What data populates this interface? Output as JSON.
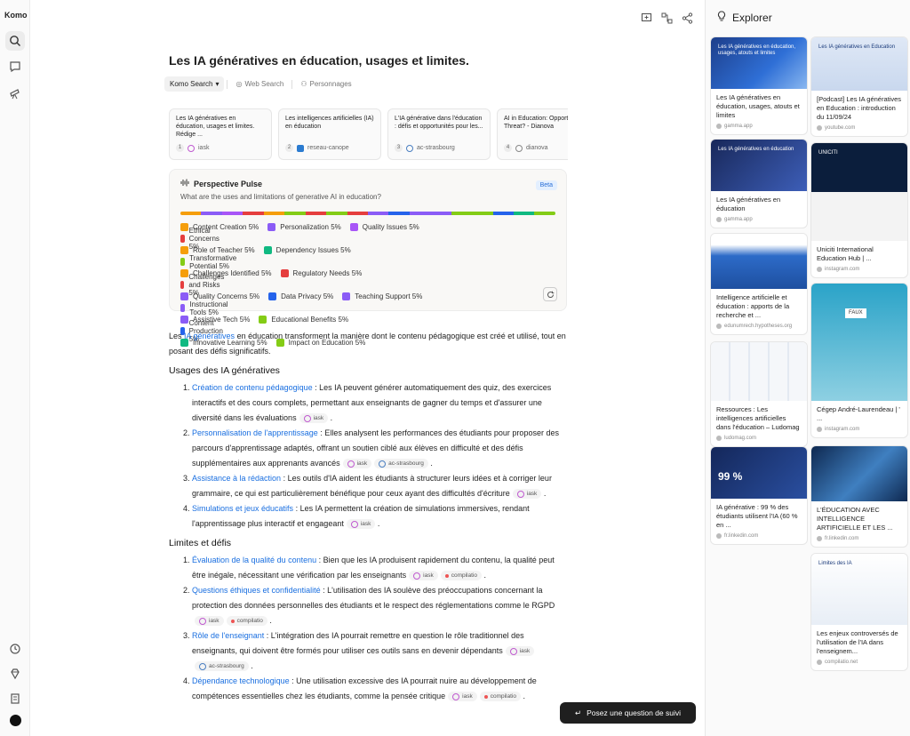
{
  "app": {
    "name": "Komo"
  },
  "main": {
    "title": "Les IA génératives en éducation, usages et limites.",
    "modes": [
      {
        "label": "Komo Search"
      },
      {
        "label": "Web Search"
      },
      {
        "label": "Personnages"
      }
    ],
    "sources": [
      {
        "num": "1",
        "title": "Les IA génératives en éducation, usages et limites. Rédige ...",
        "site": "iask"
      },
      {
        "num": "2",
        "title": "Les intelligences artificielles (IA) en éducation",
        "site": "reseau-canope"
      },
      {
        "num": "3",
        "title": "L'IA générative dans l'éducation : défis et opportunités pour les...",
        "site": "ac-strasbourg"
      },
      {
        "num": "4",
        "title": "AI in Education: Opportunity or Threat? - Dianova",
        "site": "dianova"
      }
    ],
    "followup_label": "Posez une question de suivi"
  },
  "pulse": {
    "title": "Perspective Pulse",
    "badge": "Beta",
    "question": "What are the uses and limitations of generative AI in education?",
    "bar_colors": [
      "#f59e0b",
      "#8b5cf6",
      "#a855f7",
      "#e53e3e",
      "#f59e0b",
      "#84cc16",
      "#e53e3e",
      "#84cc16",
      "#e53e3e",
      "#8b5cf6",
      "#2563eb",
      "#8b5cf6",
      "#8b5cf6",
      "#84cc16",
      "#84cc16",
      "#2563eb",
      "#10b981",
      "#84cc16"
    ],
    "items": [
      {
        "label": "Content Creation 5%",
        "color": "#f59e0b"
      },
      {
        "label": "Personalization 5%",
        "color": "#8b5cf6"
      },
      {
        "label": "Quality Issues 5%",
        "color": "#a855f7"
      },
      {
        "label": "Ethical Concerns 5%",
        "color": "#e53e3e"
      },
      {
        "label": "Role of Teacher 5%",
        "color": "#f59e0b"
      },
      {
        "label": "Dependency Issues 5%",
        "color": "#10b981"
      },
      {
        "label": "Transformative Potential 5%",
        "color": "#84cc16"
      },
      {
        "label": "Challenges Identified 5%",
        "color": "#f59e0b"
      },
      {
        "label": "Regulatory Needs 5%",
        "color": "#e53e3e"
      },
      {
        "label": "Challenges and Risks 5%",
        "color": "#e53e3e"
      },
      {
        "label": "Quality Concerns 5%",
        "color": "#8b5cf6"
      },
      {
        "label": "Data Privacy 5%",
        "color": "#2563eb"
      },
      {
        "label": "Teaching Support 5%",
        "color": "#8b5cf6"
      },
      {
        "label": "Instructional Tools 5%",
        "color": "#8b5cf6"
      },
      {
        "label": "Assistive Tech 5%",
        "color": "#8b5cf6"
      },
      {
        "label": "Educational Benefits 5%",
        "color": "#84cc16"
      },
      {
        "label": "Content Production 5%",
        "color": "#2563eb"
      },
      {
        "label": "Innovative Learning 5%",
        "color": "#10b981"
      },
      {
        "label": "Impact on Education 5%",
        "color": "#84cc16"
      }
    ]
  },
  "article": {
    "intro_prefix": "Les ",
    "intro_link": "IA génératives",
    "intro_rest": " en éducation transforment la manière dont le contenu pédagogique est créé et utilisé, tout en posant des défis significatifs.",
    "section1": "Usages des IA génératives",
    "uses": [
      {
        "link": "Création de contenu pédagogique",
        "text": " : Les IA peuvent générer automatiquement des quiz, des exercices interactifs et des cours complets, permettant aux enseignants de gagner du temps et d'assurer une diversité dans les évaluations",
        "cites": [
          "iask"
        ]
      },
      {
        "link": "Personnalisation de l'apprentissage",
        "text": " : Elles analysent les performances des étudiants pour proposer des parcours d'apprentissage adaptés, offrant un soutien ciblé aux élèves en difficulté et des défis supplémentaires aux apprenants avancés",
        "cites": [
          "iask",
          "ac-strasbourg"
        ]
      },
      {
        "link": "Assistance à la rédaction",
        "text": " : Les outils d'IA aident les étudiants à structurer leurs idées et à corriger leur grammaire, ce qui est particulièrement bénéfique pour ceux ayant des difficultés d'écriture",
        "cites": [
          "iask"
        ]
      },
      {
        "link": "Simulations et jeux éducatifs",
        "text": " : Les IA permettent la création de simulations immersives, rendant l'apprentissage plus interactif et engageant",
        "cites": [
          "iask"
        ]
      }
    ],
    "section2": "Limites et défis",
    "limits": [
      {
        "link": "Évaluation de la qualité du contenu",
        "text": " : Bien que les IA produisent rapidement du contenu, la qualité peut être inégale, nécessitant une vérification par les enseignants",
        "cites": [
          "iask",
          "compilatio"
        ]
      },
      {
        "link": "Questions éthiques et confidentialité",
        "text": " : L'utilisation des IA soulève des préoccupations concernant la protection des données personnelles des étudiants et le respect des réglementations comme le RGPD",
        "cites": [
          "iask",
          "compilatio"
        ]
      },
      {
        "link": "Rôle de l'enseignant",
        "text": " : L'intégration des IA pourrait remettre en question le rôle traditionnel des enseignants, qui doivent être formés pour utiliser ces outils sans en devenir dépendants",
        "cites": [
          "iask",
          "ac-strasbourg"
        ]
      },
      {
        "link": "Dépendance technologique",
        "text": " : Une utilisation excessive des IA pourrait nuire au développement de compétences essentielles chez les étudiants, comme la pensée critique",
        "cites": [
          "iask",
          "compilatio"
        ]
      }
    ]
  },
  "explorer": {
    "title": "Explorer",
    "left": [
      {
        "title": "Les IA génératives en éducation, usages, atouts et limites",
        "site": "gamma.app",
        "thumb": "Les IA génératives en éducation, usages, atouts et limites"
      },
      {
        "title": "Les IA génératives en éducation",
        "site": "gamma.app",
        "thumb": "Les IA génératives en éducation"
      },
      {
        "title": "Intelligence artificielle et éducation : apports de la recherche et ...",
        "site": "edunumrech.hypotheses.org",
        "thumb": ""
      },
      {
        "title": "Ressources : Les intelligences artificielles dans l'éducation – Ludomag",
        "site": "ludomag.com",
        "thumb": ""
      },
      {
        "title": "IA générative : 99 % des étudiants utilisent l'IA (60 % en ...",
        "site": "fr.linkedin.com",
        "thumb": "99 %"
      }
    ],
    "right": [
      {
        "title": "[Podcast] Les IA génératives en Education : introduction du 11/09/24",
        "site": "youtube.com",
        "thumb": "Les IA génératives en Education"
      },
      {
        "title": "Uniciti International Education Hub | ...",
        "site": "instagram.com",
        "thumb": "UNICITI"
      },
      {
        "title": "Cégep André-Laurendeau | ' ...",
        "site": "instagram.com",
        "thumb": "FAUX"
      },
      {
        "title": "L'ÉDUCATION AVEC INTELLIGENCE ARTIFICIELLE ET LES ...",
        "site": "fr.linkedin.com",
        "thumb": ""
      },
      {
        "title": "Les enjeux controversés de l'utilisation de l'IA dans l'enseignem...",
        "site": "compilatio.net",
        "thumb": "Limites des IA"
      }
    ]
  }
}
